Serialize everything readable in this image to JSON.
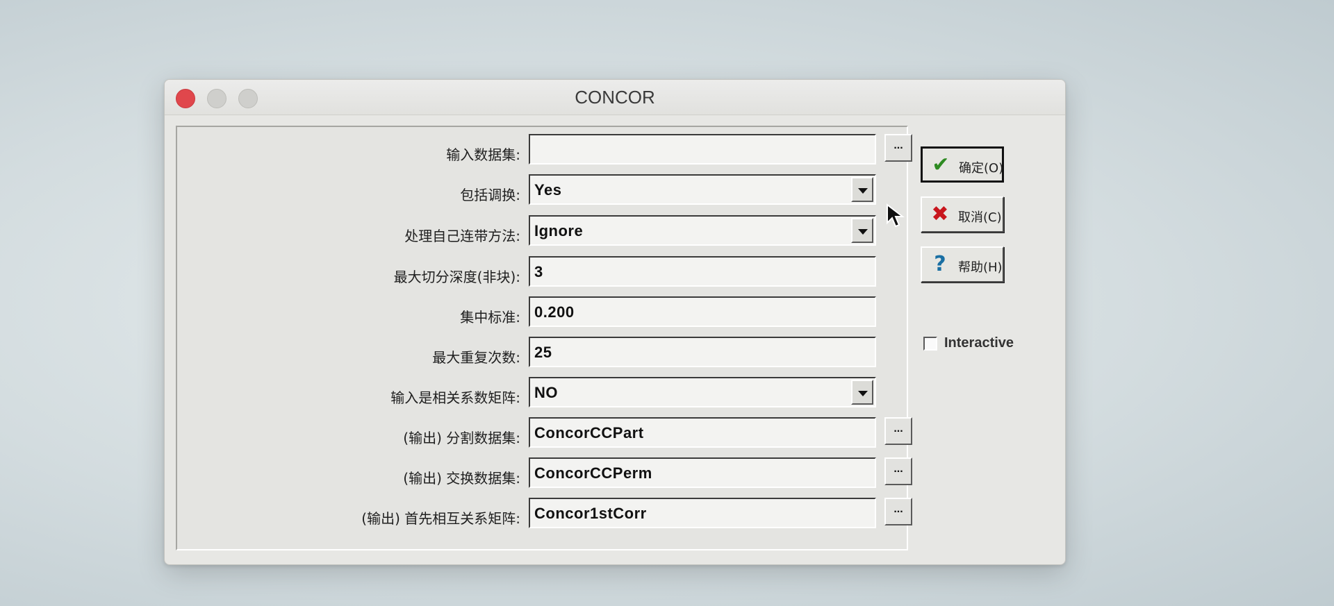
{
  "window": {
    "title": "CONCOR"
  },
  "form": {
    "rows": [
      {
        "label": "输入数据集:",
        "value": "",
        "type": "text",
        "browse": true
      },
      {
        "label": "包括调换:",
        "value": "Yes",
        "type": "select"
      },
      {
        "label": "处理自己连带方法:",
        "value": "Ignore",
        "type": "select"
      },
      {
        "label": "最大切分深度(非块):",
        "value": "3",
        "type": "text"
      },
      {
        "label": "集中标准:",
        "value": "0.200",
        "type": "text"
      },
      {
        "label": "最大重复次数:",
        "value": "25",
        "type": "text"
      },
      {
        "label": "输入是相关系数矩阵:",
        "value": "NO",
        "type": "select"
      },
      {
        "label": "(输出) 分割数据集:",
        "value": "ConcorCCPart",
        "type": "text",
        "browse": true
      },
      {
        "label": "(输出) 交换数据集:",
        "value": "ConcorCCPerm",
        "type": "text",
        "browse": true
      },
      {
        "label": "(输出) 首先相互关系矩阵:",
        "value": "Concor1stCorr",
        "type": "text",
        "browse": true
      }
    ],
    "browse_label": "..."
  },
  "buttons": {
    "ok": {
      "label": "确定(O)",
      "icon": "checkmark-icon",
      "color": "#2e8b22"
    },
    "cancel": {
      "label": "取消(C)",
      "icon": "x-icon",
      "color": "#c8161d"
    },
    "help": {
      "label": "帮助(H)",
      "icon": "question-icon",
      "color": "#1a6fa3"
    }
  },
  "interactive": {
    "label": "Interactive",
    "checked": false
  }
}
